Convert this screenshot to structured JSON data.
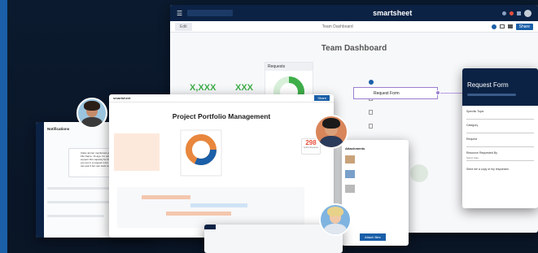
{
  "app": {
    "brand": "smartsheet"
  },
  "dashboard": {
    "breadcrumb": "Team Dashboard",
    "title": "Team Dashboard",
    "share_label": "Share",
    "edit_label": "Edit",
    "kpi_left": "X,XXX",
    "kpi_right": "XXX",
    "requests_label": "Requests"
  },
  "request_pill": {
    "label": "Request Form"
  },
  "form": {
    "title": "Request Form",
    "fields": [
      "Specific Topic",
      "Category",
      "Request",
      "Resource Requested By"
    ],
    "dropdown_value": "Select date",
    "checkbox_label": "Send me a copy of my responses"
  },
  "portfolio": {
    "brand": "smartsheet",
    "title": "Project Portfolio Management",
    "badge_value": "298",
    "badge_label": "Active Requests",
    "share": "Share"
  },
  "notifications": {
    "title": "Notifications",
    "message": "Clara Jenner mentioned you in Smartsheet File Name. 1h ago. I'm not sure we can support this capacity for this quarter. Can you put in a request in for more coverage? I can ask if Jen can work on her own too."
  },
  "attachments": {
    "title": "Attachments",
    "button": "Attach files"
  },
  "colors": {
    "navy": "#0b2244",
    "green": "#3fae49",
    "accent": "#1a5fa8",
    "orange": "#e8873d",
    "purple": "#9b7fd1"
  }
}
